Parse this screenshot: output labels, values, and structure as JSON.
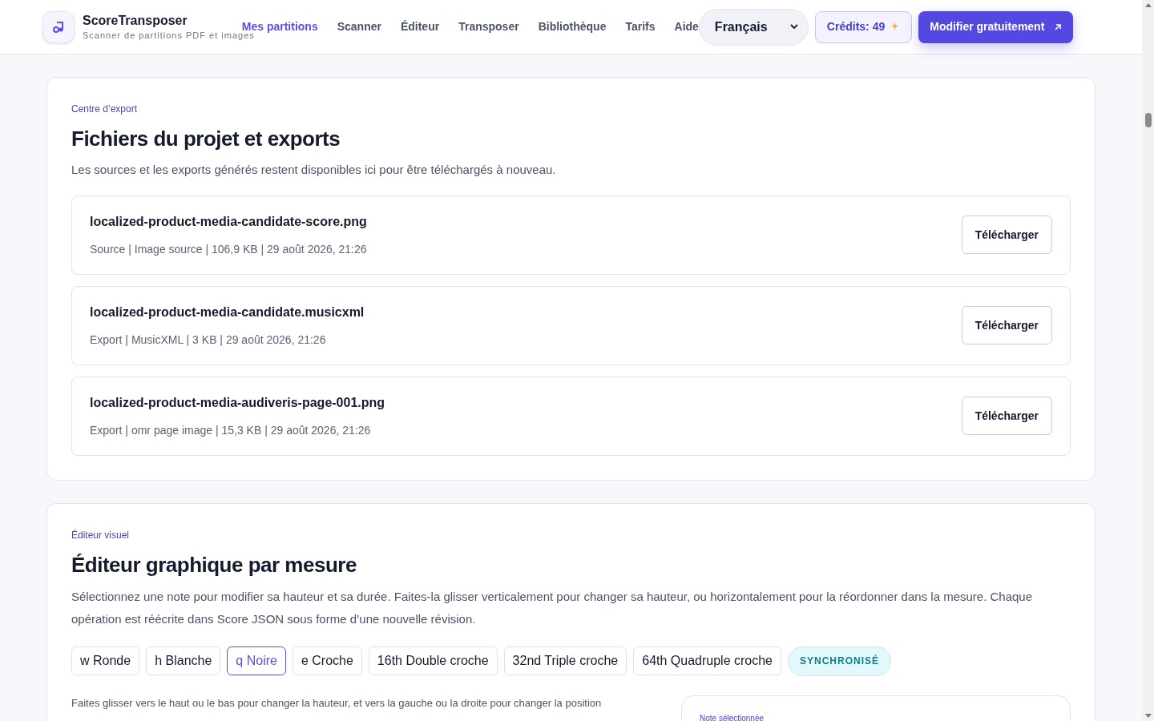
{
  "header": {
    "brand": "ScoreTransposer",
    "tagline": "Scanner de partitions PDF et images",
    "nav": [
      {
        "label": "Mes partitions",
        "selected": true
      },
      {
        "label": "Scanner",
        "selected": false
      },
      {
        "label": "Éditeur",
        "selected": false
      },
      {
        "label": "Transposer",
        "selected": false
      },
      {
        "label": "Bibliothèque",
        "selected": false
      },
      {
        "label": "Tarifs",
        "selected": false
      },
      {
        "label": "Aide",
        "selected": false
      }
    ],
    "language": "Français",
    "credits": "Crédits: 49",
    "cta": "Modifier gratuitement"
  },
  "export_center": {
    "eyebrow": "Centre d’export",
    "title": "Fichiers du projet et exports",
    "description": "Les sources et les exports générés restent disponibles ici pour être téléchargés à nouveau.",
    "files": [
      {
        "name": "localized-product-media-candidate-score.png",
        "meta": "Source | Image source | 106,9 KB | 29 août 2026, 21:26",
        "action": "Télécharger"
      },
      {
        "name": "localized-product-media-candidate.musicxml",
        "meta": "Export | MusicXML | 3 KB | 29 août 2026, 21:26",
        "action": "Télécharger"
      },
      {
        "name": "localized-product-media-audiveris-page-001.png",
        "meta": "Export | omr page image | 15,3 KB | 29 août 2026, 21:26",
        "action": "Télécharger"
      }
    ]
  },
  "visual_editor": {
    "eyebrow": "Éditeur visuel",
    "title": "Éditeur graphique par mesure",
    "description": "Sélectionnez une note pour modifier sa hauteur et sa durée. Faites-la glisser verticalement pour changer sa hauteur, ou horizontalement pour la réordonner dans la mesure. Chaque opération est réécrite dans Score JSON sous forme d’une nouvelle révision.",
    "durations": [
      {
        "symbol": "w",
        "label": "Ronde",
        "selected": false
      },
      {
        "symbol": "h",
        "label": "Blanche",
        "selected": false
      },
      {
        "symbol": "q",
        "label": "Noire",
        "selected": true
      },
      {
        "symbol": "e",
        "label": "Croche",
        "selected": false
      },
      {
        "symbol": "16th",
        "label": "Double croche",
        "selected": false
      },
      {
        "symbol": "32nd",
        "label": "Triple croche",
        "selected": false
      },
      {
        "symbol": "64th",
        "label": "Quadruple croche",
        "selected": false
      }
    ],
    "status": "SYNCHRONISÉ",
    "hint": "Faites glisser vers le haut ou le bas pour changer la hauteur, et vers la gauche ou la droite pour changer la position",
    "selected_note_label": "Note sélectionnée"
  }
}
